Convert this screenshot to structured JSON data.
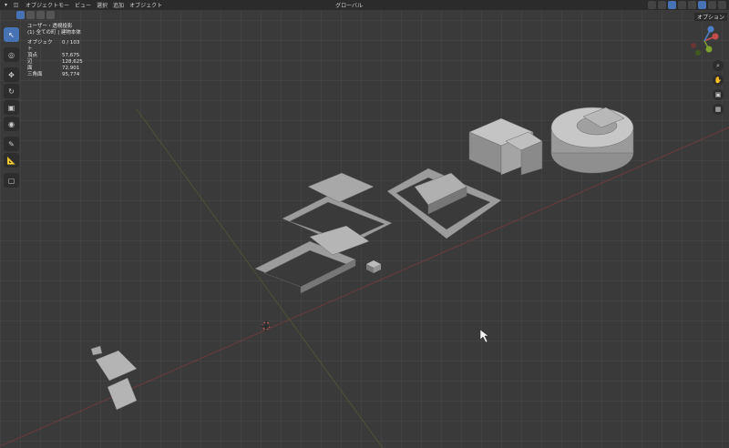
{
  "header": {
    "mode_label": "オブジェクトモー",
    "menus": [
      "ビュー",
      "選択",
      "追加",
      "オブジェクト"
    ],
    "transform_orientation": "グローバル"
  },
  "overlay_label": "オプション",
  "info": {
    "view_name": "ユーザー・透視投影",
    "collection_line": "(1) 全ての町 | 建物本体",
    "stats": [
      {
        "label": "オブジェクト",
        "value": "0 / 103"
      },
      {
        "label": "頂点",
        "value": "57,675"
      },
      {
        "label": "辺",
        "value": "128,625"
      },
      {
        "label": "面",
        "value": "72,901"
      },
      {
        "label": "三角面",
        "value": "95,774"
      }
    ]
  },
  "tools": [
    {
      "icon": "select-cursor-icon"
    },
    {
      "icon": "cursor-icon"
    },
    {
      "icon": "move-icon"
    },
    {
      "icon": "rotate-icon"
    },
    {
      "icon": "scale-icon"
    },
    {
      "icon": "transform-icon"
    },
    {
      "icon": "annotate-icon"
    },
    {
      "icon": "measure-icon"
    },
    {
      "icon": "add-cube-icon"
    }
  ],
  "nav": [
    "zoom-icon",
    "hand-icon",
    "camera-icon",
    "grid-icon"
  ],
  "colors": {
    "accent": "#4772b3",
    "x_axis": "#b04747",
    "y_axis": "#6e8a2b",
    "object": "#9a9a9a"
  }
}
